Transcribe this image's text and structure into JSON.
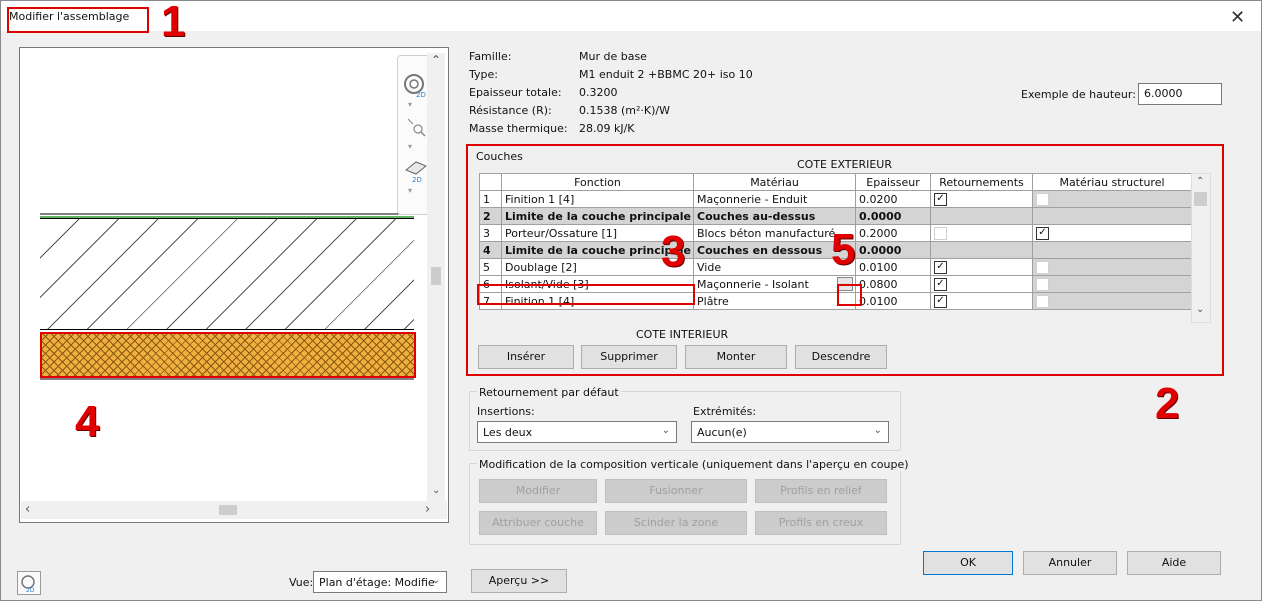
{
  "window": {
    "title": "Modifier l'assemblage",
    "close": "✕"
  },
  "annotations": [
    "1",
    "2",
    "3",
    "4",
    "5"
  ],
  "info": {
    "famille_label": "Famille:",
    "famille_value": "Mur de base",
    "type_label": "Type:",
    "type_value": "M1 enduit 2 +BBMC 20+ iso 10",
    "epaisseur_label": "Epaisseur totale:",
    "epaisseur_value": "0.3200",
    "resistance_label": "Résistance (R):",
    "resistance_value": "0.1538 (m²·K)/W",
    "masse_label": "Masse thermique:",
    "masse_value": "28.09 kJ/K",
    "exemple_label": "Exemple de hauteur:",
    "exemple_value": "6.0000"
  },
  "couches": {
    "group_label": "Couches",
    "cote_ext": "COTE EXTERIEUR",
    "cote_int": "COTE INTERIEUR",
    "headers": [
      "Fonction",
      "Matériau",
      "Epaisseur",
      "Retournements",
      "Matériau structurel"
    ],
    "rows": [
      {
        "n": "1",
        "fonction": "Finition 1 [4]",
        "materiau": "Maçonnerie - Enduit",
        "epaisseur": "0.0200",
        "retour": true,
        "struct": false
      },
      {
        "n": "2",
        "fonction": "Limite de la couche principale",
        "materiau": "Couches au-dessus",
        "epaisseur": "0.0000"
      },
      {
        "n": "3",
        "fonction": "Porteur/Ossature [1]",
        "materiau": "Blocs béton manufacturé",
        "epaisseur": "0.2000",
        "retour": false,
        "struct": true
      },
      {
        "n": "4",
        "fonction": "Limite de la couche principale",
        "materiau": "Couches en dessous",
        "epaisseur": "0.0000"
      },
      {
        "n": "5",
        "fonction": "Doublage [2]",
        "materiau": "Vide",
        "epaisseur": "0.0100",
        "retour": true,
        "struct": false
      },
      {
        "n": "6",
        "fonction": "Isolant/Vide [3]",
        "materiau": "Maçonnerie - Isolant",
        "epaisseur": "0.0800",
        "retour": true,
        "struct": false
      },
      {
        "n": "7",
        "fonction": "Finition 1 [4]",
        "materiau": "Plâtre",
        "epaisseur": "0.0100",
        "retour": true,
        "struct": false
      }
    ],
    "browse": "...",
    "buttons": {
      "inserer": "Insérer",
      "supprimer": "Supprimer",
      "monter": "Monter",
      "descendre": "Descendre"
    }
  },
  "retournement": {
    "group_label": "Retournement par défaut",
    "insertions_label": "Insertions:",
    "insertions_value": "Les deux",
    "extremites_label": "Extrémités:",
    "extremites_value": "Aucun(e)"
  },
  "vertical": {
    "group_label": "Modification de la composition verticale (uniquement dans l'aperçu en coupe)",
    "buttons": {
      "modifier": "Modifier",
      "fusionner": "Fusionner",
      "relief": "Profils en relief",
      "attribuer": "Attribuer couche",
      "scinder": "Scinder la zone",
      "creux": "Profils en creux"
    }
  },
  "footer": {
    "vue_label": "Vue:",
    "vue_value": "Plan d'étage: Modifie",
    "apercu": "Aperçu >>",
    "ok": "OK",
    "annuler": "Annuler",
    "aide": "Aide"
  },
  "icons": {
    "view2d": "2D"
  }
}
